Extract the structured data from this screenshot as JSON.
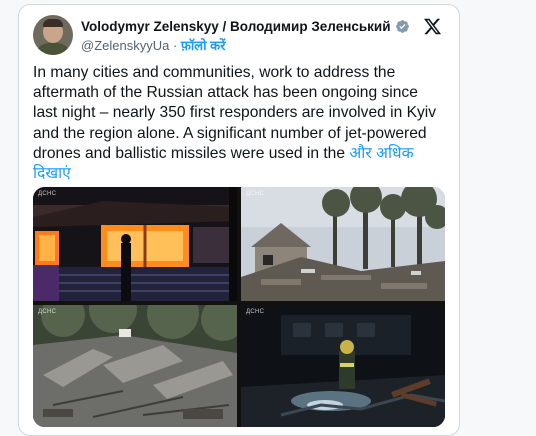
{
  "tweet": {
    "author_name": "Volodymyr Zelenskyy / Володимир Зеленський",
    "handle": "@ZelenskyyUa",
    "separator": " · ",
    "follow_label": "फ़ॉलो करें",
    "text": "In many cities and communities, work to address the aftermath of the Russian attack has been ongoing since last night – nearly 350 first responders are involved in Kyiv and the region alone. A significant number of jet-powered drones and ballistic missiles were used in the ",
    "show_more_label": "और अधिक दिखाएं",
    "media": [
      {
        "watermark": "ДСНС"
      },
      {
        "watermark": "ДСНС"
      },
      {
        "watermark": "ДСНС"
      },
      {
        "watermark": "ДСНС"
      }
    ]
  },
  "colors": {
    "accent": "#1d9bf0",
    "text": "#0f1419",
    "muted": "#536471",
    "border": "#cfd9de"
  },
  "icons": {
    "verified": "verified-badge-icon",
    "platform": "x-logo-icon"
  }
}
